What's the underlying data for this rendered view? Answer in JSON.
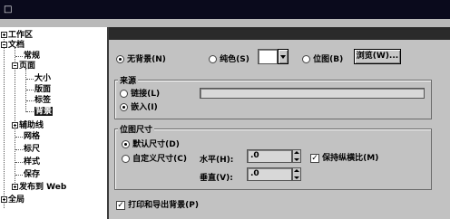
{
  "window": {
    "title": "□"
  },
  "tree": {
    "items": [
      {
        "label": "工作区",
        "toggle": "plus"
      },
      {
        "label": "文档",
        "toggle": "minus"
      },
      {
        "label": "常规"
      },
      {
        "label": "页面",
        "toggle": "minus"
      },
      {
        "label": "大小"
      },
      {
        "label": "版面"
      },
      {
        "label": "标签"
      },
      {
        "label": "背景",
        "selected": true
      },
      {
        "label": "辅助线",
        "toggle": "plus"
      },
      {
        "label": "网格"
      },
      {
        "label": "标尺"
      },
      {
        "label": "样式"
      },
      {
        "label": "保存"
      },
      {
        "label": "发布到 Web",
        "toggle": "plus"
      },
      {
        "label": "全局",
        "toggle": "plus"
      }
    ]
  },
  "background": {
    "options": [
      {
        "label": "无背景(N)",
        "selected": true
      },
      {
        "label": "纯色(S)",
        "selected": false
      },
      {
        "label": "位图(B)",
        "selected": false
      }
    ],
    "browse_label": "浏览(W)..."
  },
  "source": {
    "title": "来源",
    "options": [
      {
        "label": "链接(L)",
        "selected": false
      },
      {
        "label": "嵌入(I)",
        "selected": true
      }
    ],
    "path_value": ""
  },
  "bitmap_size": {
    "title": "位图尺寸",
    "options": [
      {
        "label": "默认尺寸(D)",
        "selected": true
      },
      {
        "label": "自定义尺寸(C)",
        "selected": false
      }
    ],
    "horizontal_label": "水平(H):",
    "horizontal_value": ".0",
    "vertical_label": "垂直(V):",
    "vertical_value": ".0",
    "keep_ratio_label": "保持纵横比(M)",
    "keep_ratio_checked": true
  },
  "print_export": {
    "label": "打印和导出背景(P)",
    "checked": true
  }
}
